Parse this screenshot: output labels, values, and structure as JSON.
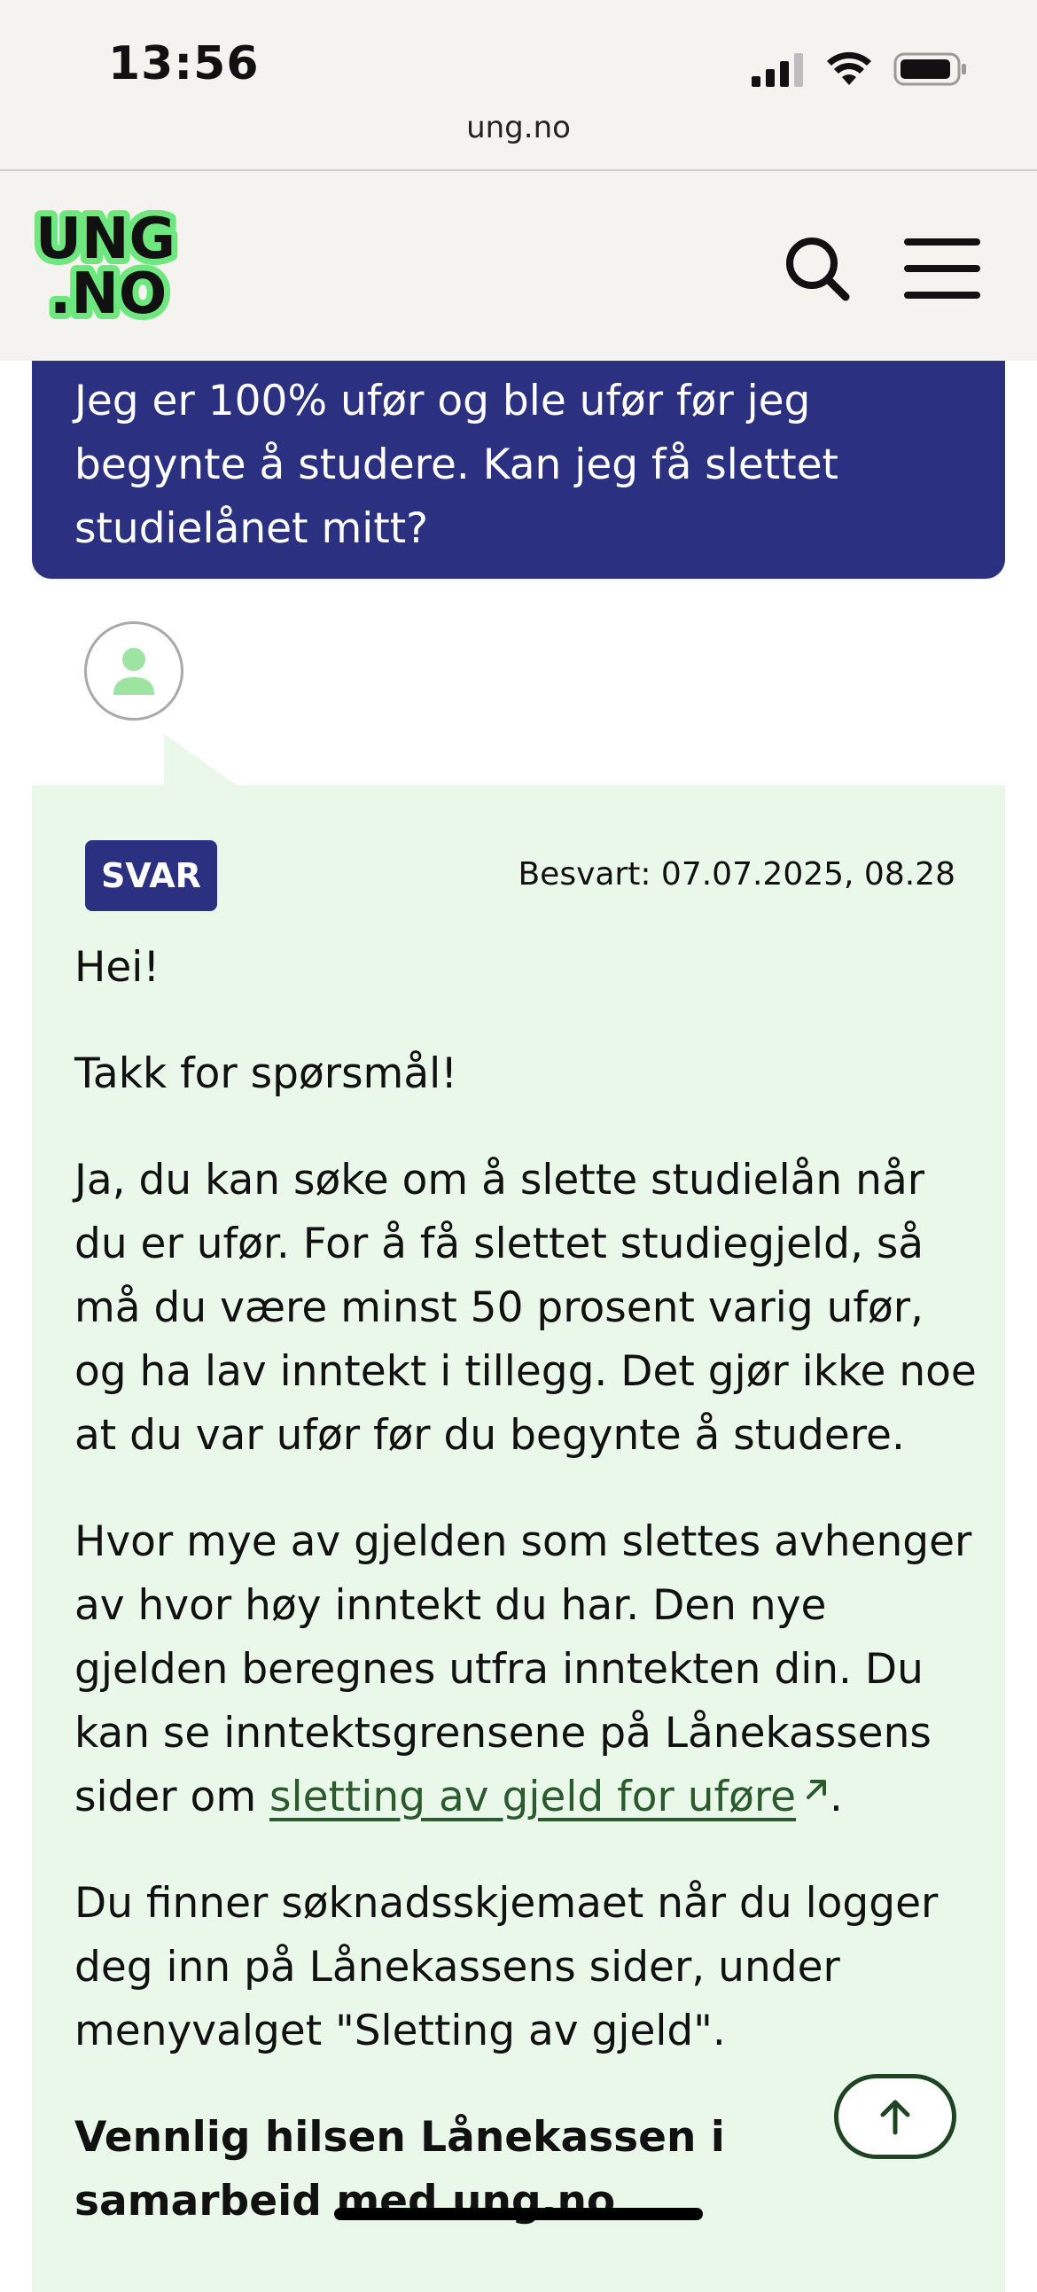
{
  "status_bar": {
    "time": "13:56",
    "url": "ung.no"
  },
  "header": {
    "logo_line1": "UNG",
    "logo_line2": ".NO",
    "logo_color": "#6ee87e",
    "search_icon": "search-icon",
    "menu_icon": "hamburger-menu-icon"
  },
  "question": {
    "text": "Jeg er 100% ufør og ble ufør før jeg begynte å studere. Kan jeg få slettet studielånet mitt?",
    "bg_color": "#2b3180"
  },
  "answer": {
    "badge": "SVAR",
    "answered_at": "Besvart: 07.07.2025, 08.28",
    "bg_color": "#eaf8e9",
    "paragraphs": {
      "p1": "Hei!",
      "p2": "Takk for spørsmål!",
      "p3": "Ja, du kan søke om å slette studielån når du er ufør. For å få slettet studiegjeld, så må du være minst 50 prosent varig ufør, og ha lav inntekt i tillegg. Det gjør ikke noe at du var ufør før du begynte å studere.",
      "p4_before": "Hvor mye av gjelden som slettes avhenger av hvor høy inntekt du har. Den nye gjelden beregnes utfra inntekten din. Du kan se inntektsgrensene på Lånekassens sider om ",
      "p4_link": "sletting av gjeld for uføre",
      "p4_after": ".",
      "p5": "Du finner søknadsskjemaet når du logger deg inn på Lånekassens sider, under menyvalget \"Sletting av gjeld\".",
      "signature": "Vennlig hilsen Lånekassen i samarbeid med ung.no"
    }
  },
  "scroll_to_top_icon": "arrow-up-icon"
}
